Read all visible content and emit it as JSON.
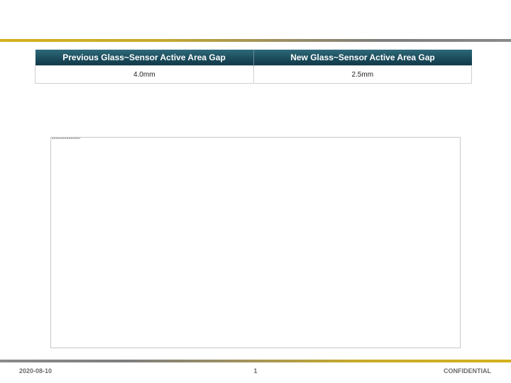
{
  "comparison_table": {
    "headers": [
      "Previous Glass~Sensor Active Area Gap",
      "New Glass~Sensor Active Area Gap"
    ],
    "values": [
      "4.0mm",
      "2.5mm"
    ]
  },
  "footer": {
    "date": "2020-08-10",
    "page_number": "1",
    "classification": "CONFIDENTIAL"
  },
  "colors": {
    "header_background": "#1c4d5c",
    "rule_gold": "#d4b11c",
    "rule_gray": "#7e7e7e",
    "footer_text": "#6b6b6b"
  }
}
